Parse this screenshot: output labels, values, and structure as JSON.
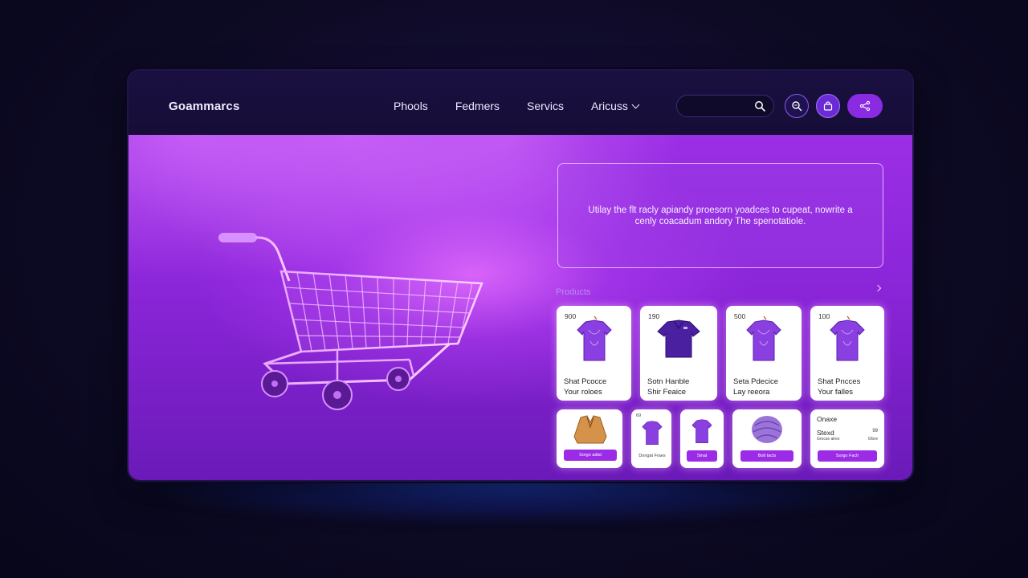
{
  "header": {
    "logo": "Goammarcs",
    "nav": [
      "Phools",
      "Fedmers",
      "Servics",
      "Aricuss"
    ],
    "search_placeholder": ""
  },
  "icons": {
    "search": "search-icon",
    "zoom": "zoom-icon",
    "bag": "shopping-bag-icon",
    "share": "share-icon",
    "cart": "shopping-cart-icon"
  },
  "promo": {
    "text": "Utilay the flt racly apiandy proesorn yoadces to cupeat, nowrite a cenly coacadum andory The spenotatiole."
  },
  "products": {
    "title": "Products",
    "row1": [
      {
        "price": "900",
        "line1": "Shat Pcocce",
        "line2": "Your roloes"
      },
      {
        "price": "190",
        "line1": "Sotn Hanble",
        "line2": "Shir Feaice"
      },
      {
        "price": "500",
        "line1": "Seta Pdecice",
        "line2": "Lay reeora"
      },
      {
        "price": "100",
        "line1": "Shat Pncces",
        "line2": "Your falles"
      }
    ],
    "row2": [
      {
        "button": "Sorgo adlal"
      },
      {
        "price": "69",
        "caption": "Dongat Fraes"
      },
      {
        "button": "Sinal"
      },
      {
        "button": "Bolt tacts"
      },
      {
        "title": "Onaxe",
        "subtitle": "Stexd",
        "meta_left": "Grocse alres",
        "meta_right": "Gfsre",
        "value": "99",
        "button": "Sorgo Fach"
      }
    ]
  },
  "colors": {
    "accent": "#8a2be2",
    "hero_top": "#9b2fe6",
    "navbar": "#1a1040",
    "card_button": "#9b2be6",
    "shirt": "#7b2fd6"
  }
}
